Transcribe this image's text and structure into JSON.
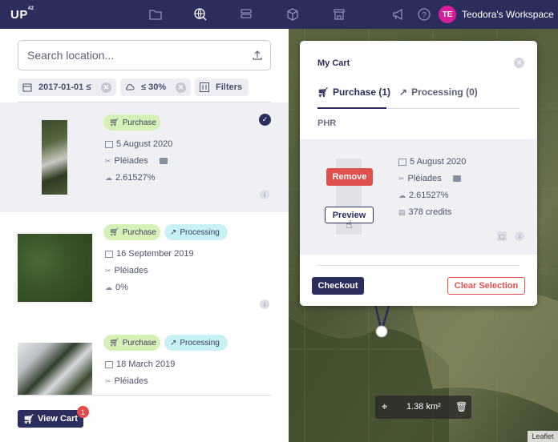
{
  "topbar": {
    "logo": "UP",
    "logo_sup": "42",
    "workspace_initials": "TE",
    "workspace_name": "Teodora's Workspace"
  },
  "search": {
    "placeholder": "Search location..."
  },
  "filters": {
    "date": "2017-01-01 ≤",
    "cloud": "≤ 30%",
    "filters_label": "Filters"
  },
  "results": [
    {
      "tags": [
        "Purchase"
      ],
      "date": "5 August 2020",
      "sensor": "Pléiades",
      "cloud": "2.61527%",
      "selected": true
    },
    {
      "tags": [
        "Purchase",
        "Processing"
      ],
      "date": "16 September 2019",
      "sensor": "Pléiades",
      "cloud": "0%",
      "selected": false
    },
    {
      "tags": [
        "Purchase",
        "Processing"
      ],
      "date": "18 March 2019",
      "sensor": "Pléiades",
      "selected": false
    }
  ],
  "view_cart": {
    "label": "View Cart",
    "badge": "1"
  },
  "cart": {
    "title": "My Cart",
    "tab_purchase": "Purchase (1)",
    "tab_processing": "Processing (0)",
    "section": "PHR",
    "item": {
      "date": "5 August 2020",
      "sensor": "Pléiades",
      "cloud": "2.61527%",
      "credits": "378 credits",
      "remove": "Remove",
      "preview": "Preview"
    },
    "checkout": "Checkout",
    "clear": "Clear Selection"
  },
  "map": {
    "area": "1.38 km²",
    "attribution": "Leaflet"
  },
  "colors": {
    "navy": "#2b2e5c",
    "purchase_bg": "#d6f0b8",
    "processing_bg": "#c8f1f4",
    "danger": "#e0514d",
    "avatar": "#d61d9a"
  }
}
